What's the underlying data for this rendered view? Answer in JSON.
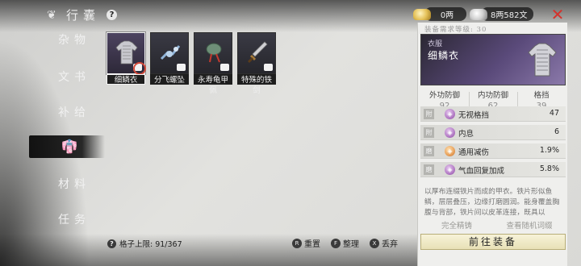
{
  "header": {
    "title": "行囊",
    "help": "?"
  },
  "currency": {
    "gold": "0两",
    "silver": "8两582文"
  },
  "nav": {
    "items": [
      {
        "label": "杂物"
      },
      {
        "label": "文书"
      },
      {
        "label": "补给"
      },
      {
        "label": ""
      },
      {
        "label": "材料"
      },
      {
        "label": "任务"
      }
    ],
    "active_icon": "robe-icon"
  },
  "inventory": {
    "items": [
      {
        "name": "细鳞衣",
        "selected": true,
        "equipped": true
      },
      {
        "name": "分飞螺坠",
        "selected": false
      },
      {
        "name": "永寿龟甲佩",
        "selected": false
      },
      {
        "name": "特殊的铁剑",
        "selected": false
      }
    ]
  },
  "bottom": {
    "capacity": "格子上限: 91/367",
    "actions": [
      {
        "key": "R",
        "label": "重置"
      },
      {
        "key": "F",
        "label": "整理"
      },
      {
        "key": "X",
        "label": "丢弃"
      }
    ]
  },
  "detail": {
    "requirement": "装备需求等级: 30",
    "category": "衣服",
    "name": "细鳞衣",
    "stats": [
      {
        "label": "外功防御",
        "value": "92"
      },
      {
        "label": "内功防御",
        "value": "62"
      },
      {
        "label": "格挡",
        "value": "39"
      }
    ],
    "attributes": [
      {
        "badge": "附",
        "gem": "gem-purple",
        "name": "无视格挡",
        "value": "47"
      },
      {
        "badge": "附",
        "gem": "gem-purple",
        "name": "内息",
        "value": "6"
      },
      {
        "badge": "磨",
        "gem": "gem-orange",
        "name": "通用减伤",
        "value": "1.9%"
      },
      {
        "badge": "磨",
        "gem": "gem-purple",
        "name": "气血回复加成",
        "value": "5.8%"
      }
    ],
    "description": "以厚布连缀铁片而成的甲衣。铁片形似鱼鳞，层层叠压，边缘打磨圆润。能身覆盖胸腹与背部，铁片间以皮革连接，既具以",
    "footer_left": "完全精铸",
    "footer_right": "查看随机词缀",
    "go_button": "前往装备"
  }
}
